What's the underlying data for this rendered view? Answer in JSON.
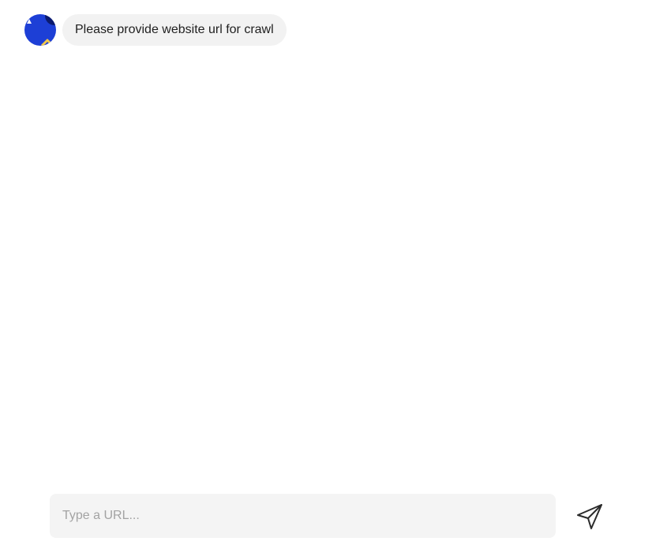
{
  "chat": {
    "bot_avatar_icon": "bot-logo-icon",
    "messages": [
      {
        "sender": "bot",
        "text": "Please provide website url for crawl"
      }
    ]
  },
  "composer": {
    "value": "",
    "placeholder": "Type a URL...",
    "send_icon": "paper-plane-icon"
  },
  "colors": {
    "avatar_blue": "#1d3fd6",
    "avatar_accent": "#f2c94c",
    "bubble_bg": "#f2f2f2",
    "input_bg": "#f4f4f4",
    "placeholder": "#a3a3a3"
  }
}
